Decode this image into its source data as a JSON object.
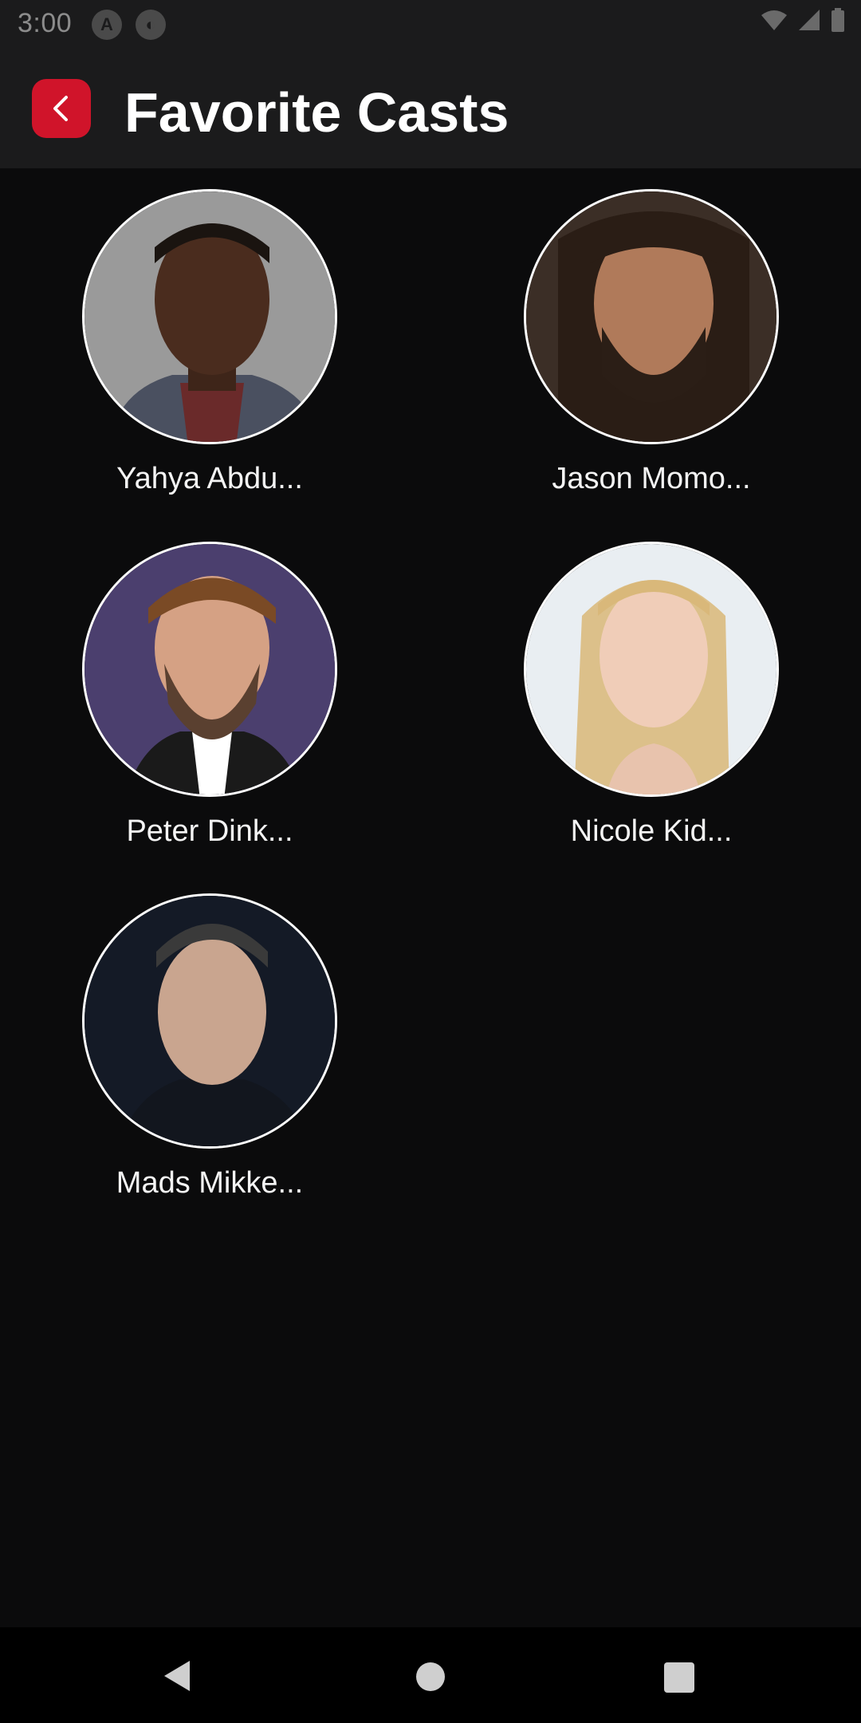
{
  "status_bar": {
    "time": "3:00"
  },
  "app_bar": {
    "title": "Favorite Casts"
  },
  "casts": [
    {
      "name": "Yahya Abdu..."
    },
    {
      "name": "Jason Momo..."
    },
    {
      "name": "Peter Dink..."
    },
    {
      "name": "Nicole Kid..."
    },
    {
      "name": "Mads Mikke..."
    }
  ],
  "colors": {
    "accent": "#d0142a",
    "background": "#0b0b0c",
    "app_bar": "#1b1b1c"
  },
  "icons": [
    "back-arrow-icon",
    "wifi-icon",
    "signal-icon",
    "battery-icon",
    "nav-back-icon",
    "nav-home-icon",
    "nav-recents-icon"
  ]
}
